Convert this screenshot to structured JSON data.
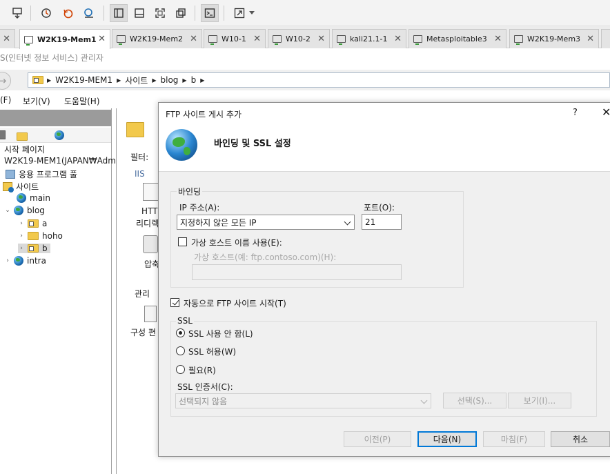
{
  "vm_tabs": [
    {
      "label": "W2K19-Mem1",
      "active": true
    },
    {
      "label": "W2K19-Mem2",
      "active": false
    },
    {
      "label": "W10-1",
      "active": false
    },
    {
      "label": "W10-2",
      "active": false
    },
    {
      "label": "kali21.1-1",
      "active": false
    },
    {
      "label": "Metasploitable3",
      "active": false
    },
    {
      "label": "W2K19-Mem3",
      "active": false
    }
  ],
  "tab_close_glyph": "✕",
  "iis": {
    "window_title": "S(인터넷 정보 서비스) 관리자",
    "address_crumbs": [
      "W2K19-MEM1",
      "사이트",
      "blog",
      "b"
    ],
    "menu": {
      "file": "(F)",
      "view": "보기(V)",
      "help": "도움말(H)"
    },
    "tree": {
      "start_page": "시작 페이지",
      "server": "W2K19-MEM1(JAPAN₩Adm",
      "app_pools": "응용 프로그램 풀",
      "sites": "사이트",
      "site_main": "main",
      "site_blog": "blog",
      "folder_a": "a",
      "folder_hoho": "hoho",
      "folder_b": "b",
      "site_intra": "intra"
    },
    "middle": {
      "filter_label": "필터:",
      "iis_group": "IIS",
      "http_redirect_1": "HTTP",
      "http_redirect_2": "리디렉",
      "compression": "압축",
      "management_group": "관리",
      "config_editor": "구성 편"
    }
  },
  "dialog": {
    "title": "FTP 사이트 게시 추가",
    "help_glyph": "?",
    "close_glyph": "✕",
    "heading": "바인딩 및 SSL 설정",
    "binding": {
      "group_label": "바인딩",
      "ip_label": "IP 주소(A):",
      "ip_value": "지정하지 않은 모든 IP",
      "port_label": "포트(O):",
      "port_value": "21",
      "vhost_checkbox_label": "가상 호스트 이름 사용(E):",
      "vhost_checked": false,
      "vhost_field_label": "가상 호스트(예: ftp.contoso.com)(H):",
      "vhost_value": ""
    },
    "autostart": {
      "label": "자동으로 FTP 사이트 시작(T)",
      "checked": true
    },
    "ssl": {
      "group_label": "SSL",
      "options": [
        {
          "label": "SSL 사용 안 함(L)",
          "selected": true
        },
        {
          "label": "SSL 허용(W)",
          "selected": false
        },
        {
          "label": "필요(R)",
          "selected": false
        }
      ],
      "cert_label": "SSL 인증서(C):",
      "cert_value": "선택되지 않음",
      "select_button": "선택(S)...",
      "view_button": "보기(I)..."
    },
    "buttons": {
      "prev": "이전(P)",
      "next": "다음(N)",
      "finish": "마침(F)",
      "cancel": "취소"
    }
  }
}
